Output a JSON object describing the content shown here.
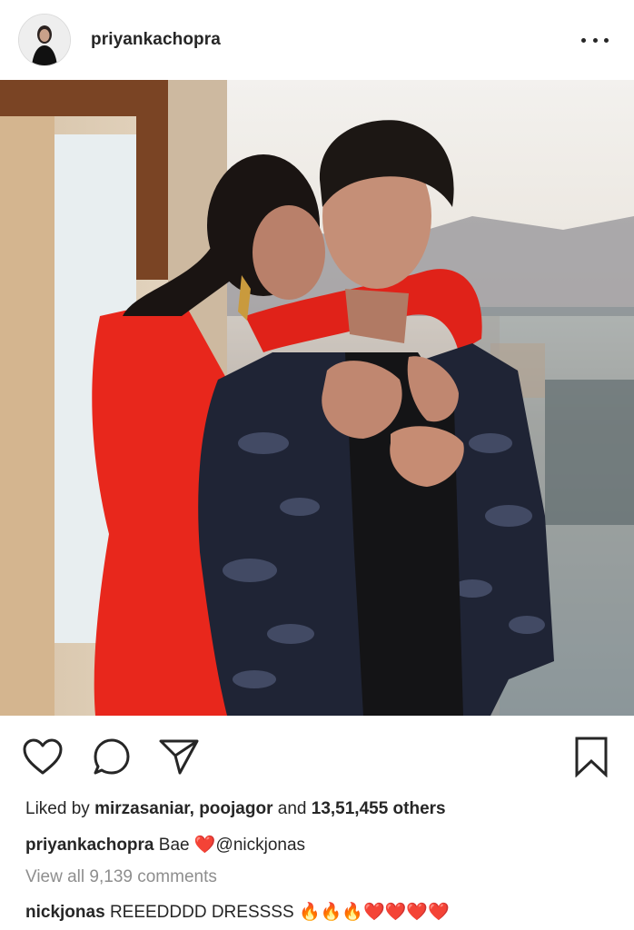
{
  "header": {
    "username": "priyankachopra",
    "avatar_icon": "profile-avatar",
    "more_icon": "more-options-icon"
  },
  "photo": {
    "alt": "post-photo"
  },
  "actions": {
    "like_icon": "heart-outline-icon",
    "comment_icon": "comment-bubble-icon",
    "share_icon": "paper-plane-icon",
    "save_icon": "bookmark-icon"
  },
  "likes": {
    "prefix": "Liked by",
    "user1": "mirzasaniar",
    "separator": ",",
    "user2": "poojagor",
    "and": "and",
    "others": "13,51,455 others"
  },
  "caption": {
    "username": "priyankachopra",
    "text": "Bae",
    "emoji": "❤️",
    "mention": "@nickjonas"
  },
  "view_comments": "View all 9,139 comments",
  "comment": {
    "username": "nickjonas",
    "text": "REEEDDDD DRESSSS",
    "emoji_fire": [
      "🔥",
      "🔥",
      "🔥"
    ],
    "emoji_heart": [
      "❤️",
      "❤️",
      "❤️",
      "❤️"
    ]
  }
}
